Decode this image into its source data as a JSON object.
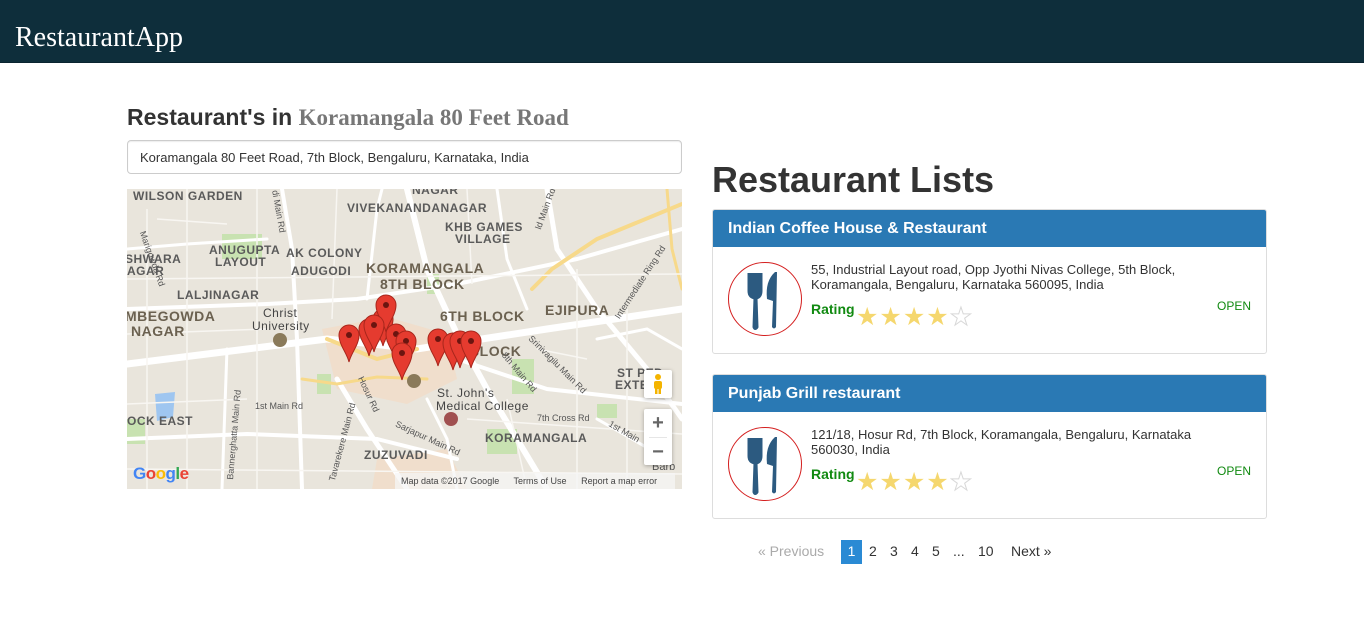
{
  "app": {
    "brand": "RestaurantApp"
  },
  "location": {
    "heading_prefix": "Restaurant's in",
    "name": "Koramangala 80 Feet Road",
    "search_value": "Koramangala 80 Feet Road, 7th Block, Bengaluru, Karnataka, India"
  },
  "map": {
    "labels": {
      "wilson_garden": "WILSON GARDEN",
      "nagar_top": "NAGAR",
      "vivekanandanagar": "VIVEKANANDANAGAR",
      "khb_games": "KHB GAMES",
      "village": "VILLAGE",
      "marigowda": "Marigowda Rd",
      "anugupta": "ANUGUPTA",
      "layout": "LAYOUT",
      "ak_colony": "AK COLONY",
      "adugodi": "ADUGODI",
      "shwara": "SHWARA",
      "agar": "AGAR",
      "koramangala_8th": "KORAMANGALA",
      "block_8th": "8TH BLOCK",
      "intermediate_ring": "Intermediate Ring Rd",
      "laljinagar": "LALJINAGAR",
      "ejipura": "EJIPURA",
      "mbegowda": "MBEGOWDA",
      "nagar": "NAGAR",
      "christ": "Christ",
      "university": "University",
      "block_6th": "6TH BLOCK",
      "th_block": "TH BLOCK",
      "srinivagilu": "Srinivagilu Main Rd",
      "main_8th": "8th Main Rd",
      "st_ped": "ST PED",
      "exte": "EXTE",
      "stjohns": "St. John's",
      "medical": "Medical College",
      "main_1st": "1st Main Rd",
      "cross_7th": "7th Cross Rd",
      "main_1st_r": "1st Main",
      "ock_east": "OCK EAST",
      "bannerghatta": "Bannerghatta Main Rd",
      "tavarekere": "Tavarekere Main Rd",
      "hosur": "Hosur Rd",
      "sarjapur": "Sarjapur Main Rd",
      "koramangala": "KORAMANGALA",
      "zuzuvadi": "ZUZUVADI",
      "main_rd_top": "di Main Rd",
      "main_rd_top2": "ld Main Rd",
      "barb": "Barb"
    },
    "zoom_in": "+",
    "zoom_out": "−",
    "google": [
      "G",
      "o",
      "o",
      "g",
      "l",
      "e"
    ],
    "google_colors": [
      "#4285f4",
      "#ea4335",
      "#fbbc05",
      "#4285f4",
      "#34a853",
      "#ea4335"
    ],
    "footer": {
      "data": "Map data ©2017 Google",
      "terms": "Terms of Use",
      "report": "Report a map error"
    },
    "pin_color": "#e53b2f"
  },
  "list": {
    "title": "Restaurant Lists",
    "restaurants": [
      {
        "name": "Indian Coffee House & Restaurant",
        "address": "55, Industrial Layout road, Opp Jyothi Nivas College, 5th Block, Koramangala, Bengaluru, Karnataka 560095, India",
        "rating_label": "Rating",
        "rating": 4,
        "max_rating": 5,
        "status": "OPEN"
      },
      {
        "name": "Punjab Grill restaurant",
        "address": "121/18, Hosur Rd, 7th Block, Koramangala, Bengaluru, Karnataka 560030, India",
        "rating_label": "Rating",
        "rating": 4,
        "max_rating": 5,
        "status": "OPEN"
      }
    ]
  },
  "pagination": {
    "previous": "«  Previous",
    "pages": [
      "1",
      "2",
      "3",
      "4",
      "5",
      "...",
      "10"
    ],
    "active": "1",
    "next": "Next  »"
  },
  "colors": {
    "navbar": "#0e2e3b",
    "card_header": "#2a79b4",
    "rating": "#118a11",
    "star": "#f5d76e",
    "active_page": "#2a8ad4"
  }
}
